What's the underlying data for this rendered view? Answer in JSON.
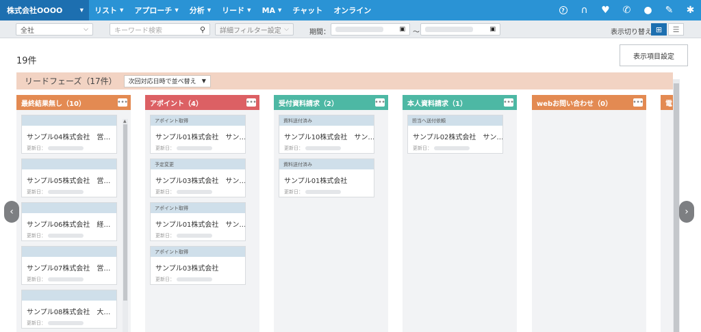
{
  "nav": {
    "brand": "株式会社OOOO",
    "items": [
      {
        "label": "リスト",
        "caret": true
      },
      {
        "label": "アプローチ",
        "caret": true
      },
      {
        "label": "分析",
        "caret": true
      },
      {
        "label": "リード",
        "caret": true
      },
      {
        "label": "MA",
        "caret": true
      },
      {
        "label": "チャット",
        "caret": false
      },
      {
        "label": "オンライン",
        "caret": false
      }
    ],
    "icons": [
      "help-icon",
      "headset-icon",
      "heart-icon",
      "phone-icon",
      "chat-bubble-icon",
      "pencil-icon",
      "gear-icon"
    ]
  },
  "filters": {
    "company": "全社",
    "keyword_placeholder": "キーワード検索",
    "detail_filter": "詳細フィルター設定",
    "period_label": "期間：",
    "range_sep": "～",
    "view_toggle_label": "表示切り替え"
  },
  "count_text": "19件",
  "settings_button": "表示項目設定",
  "phase": {
    "title": "リードフェーズ（17件）",
    "sort": "次回対応日時で並べ替え"
  },
  "date_label": "更新日：",
  "columns": [
    {
      "title": "最終結果無し（10）",
      "color": "#e38a52",
      "cards": [
        {
          "tag": "",
          "name": "サンプル04株式会社　営…"
        },
        {
          "tag": "",
          "name": "サンプル05株式会社　営…"
        },
        {
          "tag": "",
          "name": "サンプル06株式会社　経…"
        },
        {
          "tag": "",
          "name": "サンプル07株式会社　営…"
        },
        {
          "tag": "",
          "name": "サンプル08株式会社　大…"
        }
      ]
    },
    {
      "title": "アポイント（4）",
      "color": "#dc6064",
      "cards": [
        {
          "tag": "アポイント取得",
          "name": "サンプル01株式会社　サン…"
        },
        {
          "tag": "予定変更",
          "name": "サンプル03株式会社　サン…"
        },
        {
          "tag": "アポイント取得",
          "name": "サンプル01株式会社　サン…"
        },
        {
          "tag": "アポイント取得",
          "name": "サンプル03株式会社"
        }
      ]
    },
    {
      "title": "受付資料請求（2）",
      "color": "#4db8a4",
      "cards": [
        {
          "tag": "資料送付済み",
          "name": "サンプル10株式会社　サン…"
        },
        {
          "tag": "資料送付済み",
          "name": "サンプル01株式会社"
        }
      ]
    },
    {
      "title": "本人資料請求（1）",
      "color": "#4db8a4",
      "cards": [
        {
          "tag": "担当へ送付依頼",
          "name": "サンプル02株式会社　サン…"
        }
      ]
    },
    {
      "title": "webお問い合わせ（0）",
      "color": "#e38a52",
      "cards": []
    },
    {
      "title": "電",
      "color": "#e38a52",
      "cards": []
    }
  ]
}
